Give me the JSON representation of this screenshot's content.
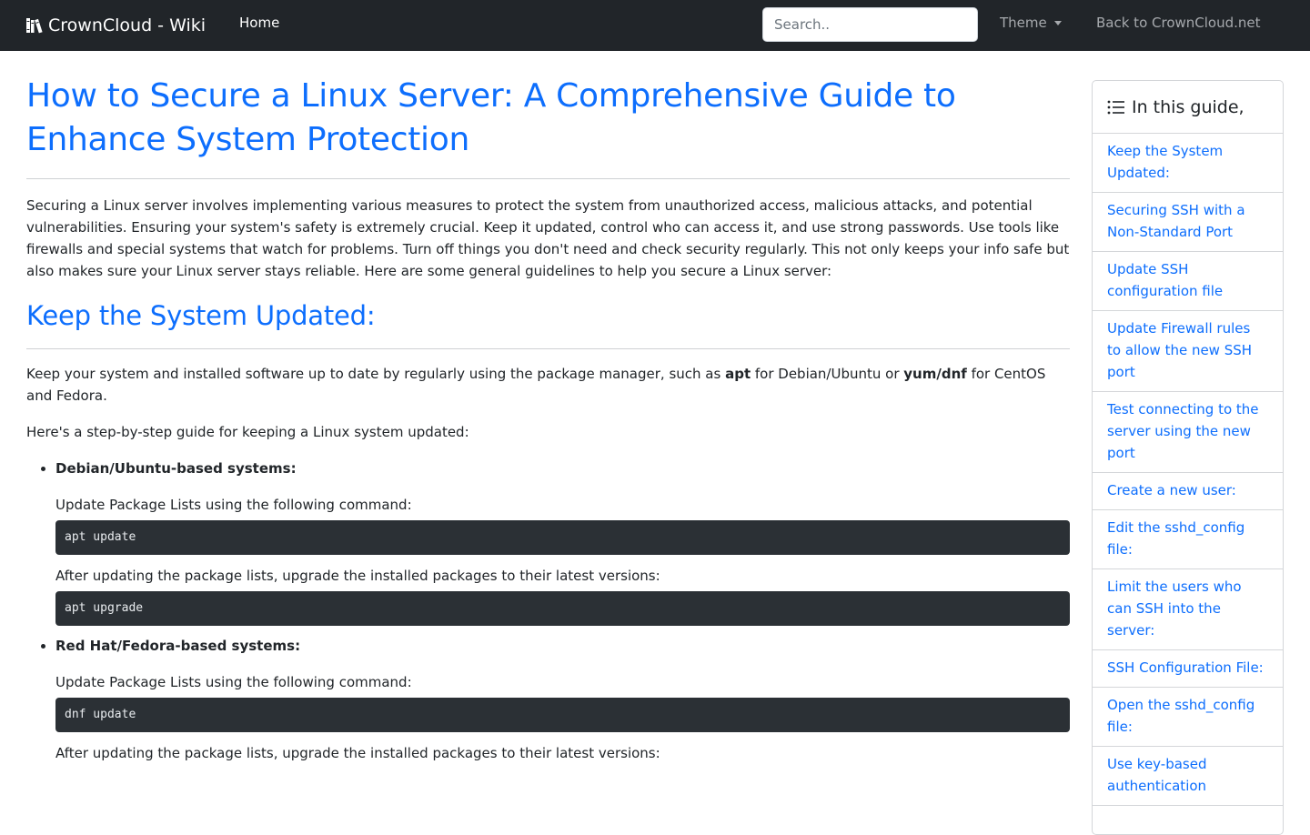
{
  "navbar": {
    "brand": "CrownCloud - Wiki",
    "home": "Home",
    "search_placeholder": "Search..",
    "theme": "Theme",
    "back": "Back to CrownCloud.net"
  },
  "article": {
    "title": "How to Secure a Linux Server: A Comprehensive Guide to Enhance System Protection",
    "intro": "Securing a Linux server involves implementing various measures to protect the system from unauthorized access, malicious attacks, and potential vulnerabilities. Ensuring your system's safety is extremely crucial. Keep it updated, control who can access it, and use strong passwords. Use tools like firewalls and special systems that watch for problems. Turn off things you don't need and check security regularly. This not only keeps your info safe but also makes sure your Linux server stays reliable. Here are some general guidelines to help you secure a Linux server:",
    "section1": {
      "heading": "Keep the System Updated:",
      "para_pre": "Keep your system and installed software up to date by regularly using the package manager, such as ",
      "bold1": "apt",
      "para_mid": " for Debian/Ubuntu or ",
      "bold2": "yum/dnf",
      "para_post": " for CentOS and Fedora.",
      "guide_intro": "Here's a step-by-step guide for keeping a Linux system updated:",
      "systems": [
        {
          "name": "Debian/Ubuntu-based systems:",
          "step1": "Update Package Lists using the following command:",
          "cmd1": "apt update",
          "step2": "After updating the package lists, upgrade the installed packages to their latest versions:",
          "cmd2": "apt upgrade"
        },
        {
          "name": "Red Hat/Fedora-based systems:",
          "step1": "Update Package Lists using the following command:",
          "cmd1": "dnf update",
          "step2": "After updating the package lists, upgrade the installed packages to their latest versions:"
        }
      ]
    }
  },
  "toc": {
    "title": "In this guide,",
    "items": [
      "Keep the System Updated:",
      "Securing SSH with a Non-Standard Port",
      "Update SSH configuration file",
      "Update Firewall rules to allow the new SSH port",
      "Test connecting to the server using the new port",
      "Create a new user:",
      "Edit the sshd_config file:",
      "Limit the users who can SSH into the server:",
      "SSH Configuration File:",
      "Open the sshd_config file:",
      "Use key-based authentication"
    ]
  },
  "colors": {
    "navbar_bg": "#212529",
    "link": "#0d6efd",
    "code_bg": "#2b3035"
  },
  "icons": {
    "brand": "books-icon",
    "toc": "list-icon"
  }
}
